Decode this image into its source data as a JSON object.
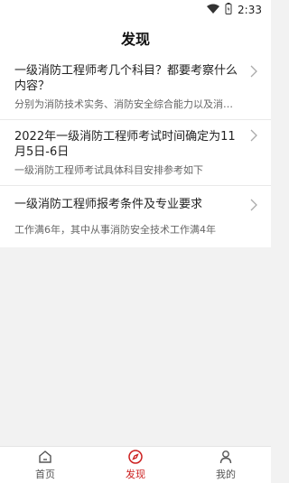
{
  "status": {
    "time": "2:33"
  },
  "header": {
    "title": "发现"
  },
  "articles": [
    {
      "title": "一级消防工程师考几个科目？都要考察什么内容？",
      "desc": "分别为消防技术实务、消防安全综合能力以及消防..."
    },
    {
      "title": "2022年一级消防工程师考试时间确定为11月5日-6日",
      "desc": "一级消防工程师考试具体科目安排参考如下"
    },
    {
      "title": "一级消防工程师报考条件及专业要求",
      "desc": "工作满6年，其中从事消防安全技术工作满4年"
    }
  ],
  "tabs": [
    {
      "label": "首页",
      "icon": "home-icon"
    },
    {
      "label": "发现",
      "icon": "compass-icon",
      "active": true
    },
    {
      "label": "我的",
      "icon": "person-icon"
    }
  ],
  "colors": {
    "accent": "#cc1f1f"
  }
}
